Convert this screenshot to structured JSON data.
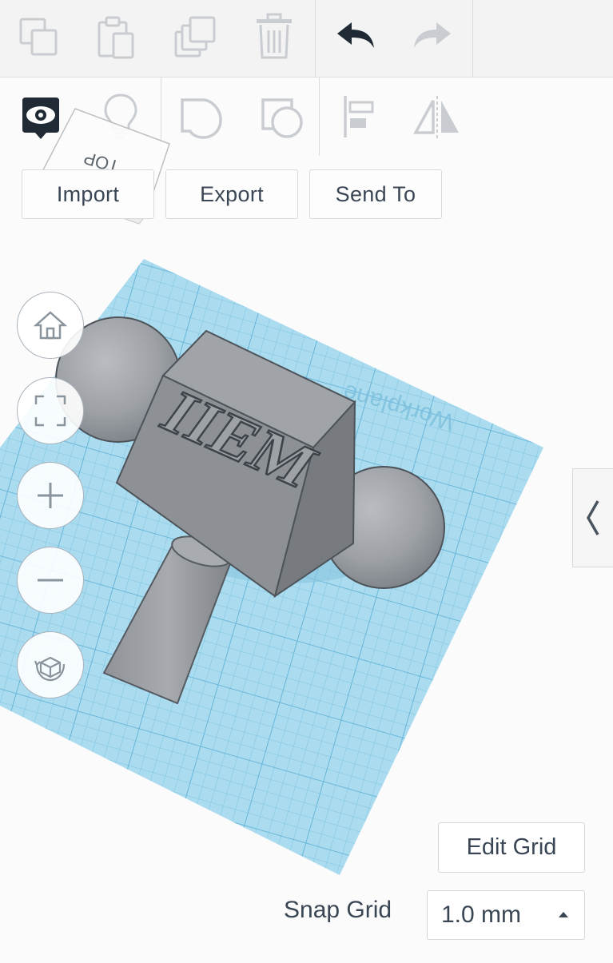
{
  "toolbar": {
    "copy_icon": "copy-icon",
    "paste_icon": "paste-icon",
    "duplicate_icon": "duplicate-icon",
    "delete_icon": "trash-icon",
    "undo_icon": "undo-icon",
    "redo_icon": "redo-icon"
  },
  "tools": {
    "notes_icon": "eye-comment-icon",
    "light_icon": "lightbulb-icon",
    "group_icon": "group-shapes-icon",
    "ungroup_icon": "ungroup-shapes-icon",
    "align_icon": "align-icon",
    "mirror_icon": "mirror-icon"
  },
  "actions": {
    "import_label": "Import",
    "export_label": "Export",
    "send_to_label": "Send To"
  },
  "viewcube": {
    "face_label": "TOP"
  },
  "model": {
    "emboss_text": "IIEM"
  },
  "workplane": {
    "label": "Workplane",
    "color": "#a9dbef"
  },
  "view_controls": {
    "home_icon": "home-icon",
    "fit_icon": "fit-view-icon",
    "zoom_in_icon": "plus-icon",
    "zoom_out_icon": "minus-icon",
    "perspective_icon": "cube-view-icon"
  },
  "side_panel": {
    "toggle_icon": "chevron-left-icon"
  },
  "grid": {
    "edit_label": "Edit Grid",
    "snap_label": "Snap Grid",
    "snap_value": "1.0 mm"
  }
}
